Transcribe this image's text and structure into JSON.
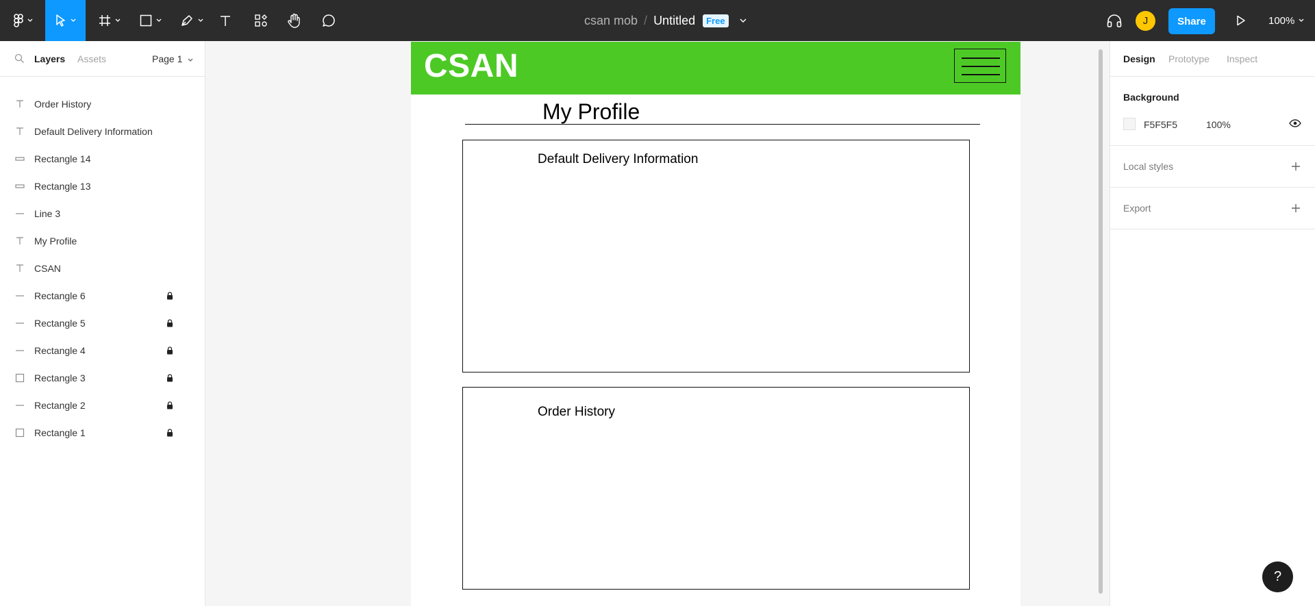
{
  "toolbar": {
    "project": "csan mob",
    "separator": "/",
    "filename": "Untitled",
    "plan_badge": "Free",
    "avatar_initial": "J",
    "share_label": "Share",
    "zoom": "100%"
  },
  "left_panel": {
    "tab_layers": "Layers",
    "tab_assets": "Assets",
    "page": "Page 1",
    "layers": [
      {
        "name": "Order History",
        "icon": "text-icon",
        "locked": false
      },
      {
        "name": "Default Delivery Information",
        "icon": "text-icon",
        "locked": false
      },
      {
        "name": "Rectangle 14",
        "icon": "thin-rect-icon",
        "locked": false
      },
      {
        "name": "Rectangle 13",
        "icon": "thin-rect-icon",
        "locked": false
      },
      {
        "name": "Line 3",
        "icon": "line-icon",
        "locked": false
      },
      {
        "name": "My Profile",
        "icon": "text-icon",
        "locked": false
      },
      {
        "name": "CSAN",
        "icon": "text-icon",
        "locked": false
      },
      {
        "name": "Rectangle 6",
        "icon": "line-icon",
        "locked": true
      },
      {
        "name": "Rectangle 5",
        "icon": "line-icon",
        "locked": true
      },
      {
        "name": "Rectangle 4",
        "icon": "line-icon",
        "locked": true
      },
      {
        "name": "Rectangle 3",
        "icon": "rect-icon",
        "locked": true
      },
      {
        "name": "Rectangle 2",
        "icon": "line-icon",
        "locked": true
      },
      {
        "name": "Rectangle 1",
        "icon": "rect-icon",
        "locked": true
      }
    ]
  },
  "canvas": {
    "header_logo": "CSAN",
    "page_title": "My Profile",
    "card1_title": "Default Delivery Information",
    "card2_title": "Order History",
    "header_color": "#4dc926"
  },
  "right_panel": {
    "tab_design": "Design",
    "tab_prototype": "Prototype",
    "tab_inspect": "Inspect",
    "background_label": "Background",
    "background_hex": "F5F5F5",
    "background_opacity": "100%",
    "local_styles_label": "Local styles",
    "export_label": "Export"
  },
  "help_label": "?",
  "colors": {
    "accent": "#0d99ff",
    "toolbar_bg": "#2c2c2c",
    "avatar": "#ffc700"
  }
}
